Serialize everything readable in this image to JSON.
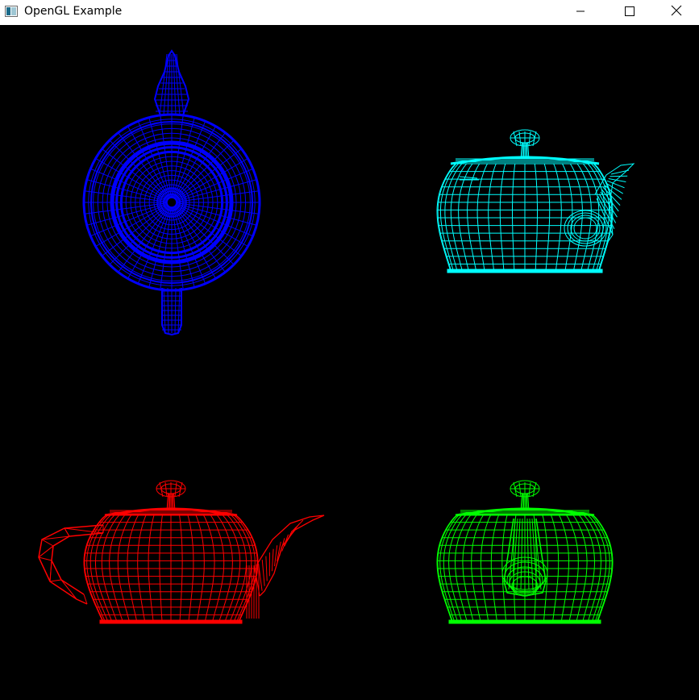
{
  "window": {
    "title": "OpenGL Example",
    "icons": {
      "app": "opengl-app-icon",
      "minimize": "minimize-icon",
      "maximize": "maximize-icon",
      "close": "close-icon"
    }
  },
  "viewport": {
    "background": "#000000",
    "teapots": [
      {
        "name": "top-view",
        "color": "#0000ff"
      },
      {
        "name": "side-view-spout-right",
        "color": "#00ffff"
      },
      {
        "name": "front-view",
        "color": "#ff0000"
      },
      {
        "name": "back-view",
        "color": "#00ff00"
      }
    ]
  }
}
